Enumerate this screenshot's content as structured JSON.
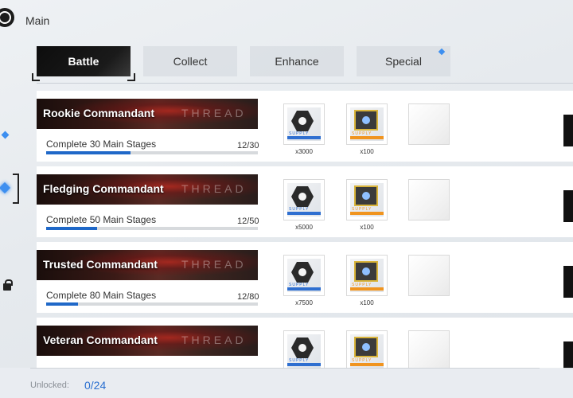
{
  "header": {
    "crumb": "Main"
  },
  "tabs": [
    {
      "label": "Battle",
      "active": true
    },
    {
      "label": "Collect",
      "active": false
    },
    {
      "label": "Enhance",
      "active": false
    },
    {
      "label": "Special",
      "active": false
    }
  ],
  "rows": [
    {
      "title": "Rookie Commandant",
      "watermark": "THREAD",
      "task": "Complete 30 Main Stages",
      "count": "12/30",
      "progress": 0.4,
      "rewards": [
        {
          "icon": "hex-nut-icon",
          "qty": "x3000"
        },
        {
          "icon": "supply-chip-icon",
          "qty": "x100"
        }
      ]
    },
    {
      "title": "Fledging Commandant",
      "watermark": "THREAD",
      "task": "Complete 50 Main Stages",
      "count": "12/50",
      "progress": 0.24,
      "rewards": [
        {
          "icon": "hex-nut-icon",
          "qty": "x5000"
        },
        {
          "icon": "supply-chip-icon",
          "qty": "x100"
        }
      ]
    },
    {
      "title": "Trusted Commandant",
      "watermark": "THREAD",
      "task": "Complete 80 Main Stages",
      "count": "12/80",
      "progress": 0.15,
      "rewards": [
        {
          "icon": "hex-nut-icon",
          "qty": "x7500"
        },
        {
          "icon": "supply-chip-icon",
          "qty": "x100"
        }
      ]
    },
    {
      "title": "Veteran Commandant",
      "watermark": "THREAD",
      "task": "",
      "count": "",
      "progress": 0,
      "rewards": [
        {
          "icon": "hex-nut-icon",
          "qty": ""
        },
        {
          "icon": "supply-chip-icon",
          "qty": ""
        }
      ]
    }
  ],
  "reward_badge": {
    "text": "SUPPLY"
  },
  "footer": {
    "unlocked_label": "Unlocked:",
    "unlocked_value": "0/24"
  },
  "colors": {
    "accent": "#1f68c8",
    "highlight": "#3d8ff0",
    "supply_orange": "#f0941f"
  }
}
